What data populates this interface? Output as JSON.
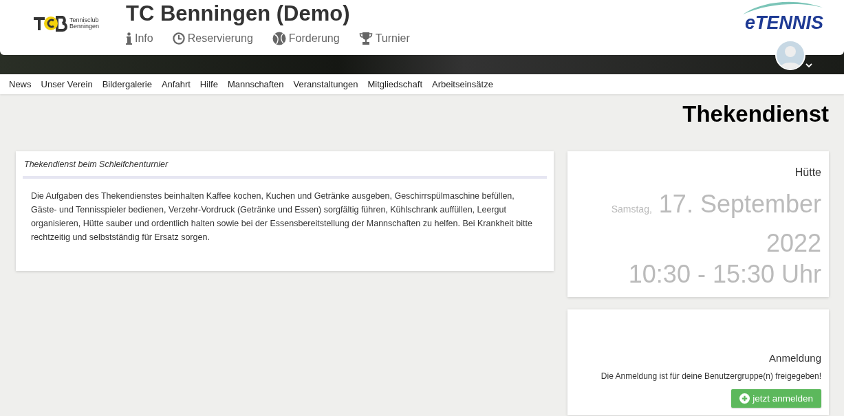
{
  "header": {
    "logo_lines": [
      "Tennisclub",
      "Benningen"
    ],
    "title": "TC Benningen (Demo)",
    "brand": "eTENNIS",
    "menu": [
      {
        "label": "Info",
        "kind": "info"
      },
      {
        "label": "Reservierung",
        "kind": "clock"
      },
      {
        "label": "Forderung",
        "kind": "ball"
      },
      {
        "label": "Turnier",
        "kind": "trophy"
      }
    ]
  },
  "nav": [
    "News",
    "Unser Verein",
    "Bildergalerie",
    "Anfahrt",
    "Hilfe",
    "Mannschaften",
    "Veranstaltungen",
    "Mitgliedschaft",
    "Arbeitseinsätze"
  ],
  "page_title": "Thekendienst",
  "description": {
    "title": "Thekendienst beim Schleifchenturnier",
    "text": "Die Aufgaben des Thekendienstes beinhalten Kaffee kochen, Kuchen und Getränke ausgeben, Geschirrspülmaschine befüllen, Gäste- und Tennisspieler bedienen, Verzehr-Vordruck (Getränke und Essen) sorgfältig führen, Kühlschrank auffüllen, Leergut organisieren, Hütte sauber und ordentlich halten sowie bei der Essensbereitstellung der Mannschaften zu helfen. Bei Krankheit bitte rechtzeitig und selbstständig für Ersatz sorgen."
  },
  "event": {
    "location": "Hütte",
    "weekday": "Samstag,",
    "date": "17. September 2022",
    "time": "10:30 - 15:30 Uhr"
  },
  "signup": {
    "title": "Anmeldung",
    "message": "Die Anmeldung ist für deine Benutzergruppe(n) freigegeben!",
    "button": "jetzt anmelden"
  }
}
